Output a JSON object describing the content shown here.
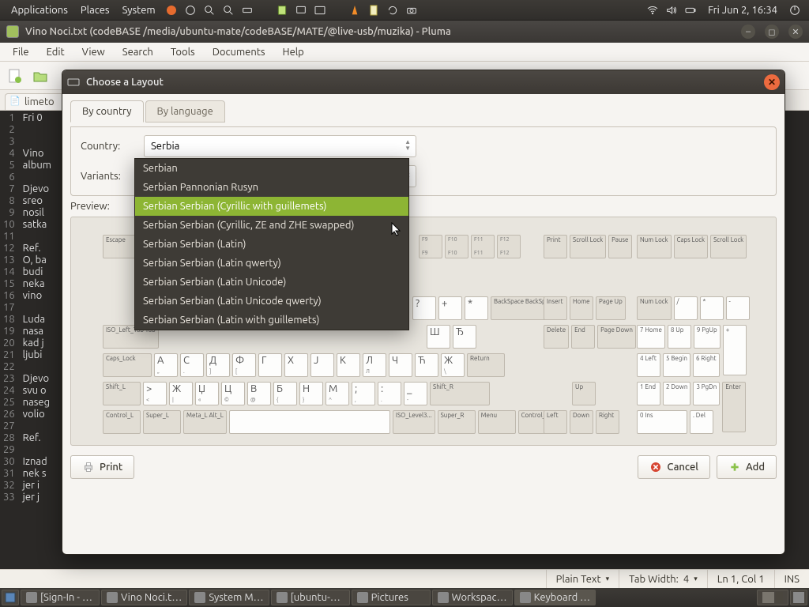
{
  "top_panel": {
    "menus": [
      "Applications",
      "Places",
      "System"
    ],
    "clock": "Fri Jun  2, 16:34"
  },
  "pluma": {
    "window_title": "Vino Noci.txt (codeBASE /media/ubuntu-mate/codeBASE/MATE/@live-usb/muzika) - Pluma",
    "menubar": [
      "File",
      "Edit",
      "View",
      "Search",
      "Tools",
      "Documents",
      "Help"
    ],
    "tab": "limeto",
    "code_lines": [
      "Fri 0",
      "",
      "",
      "Vino ",
      "album",
      "",
      "Djevo",
      "sreo ",
      "nosil",
      "satka",
      "",
      "Ref. ",
      "O, ba",
      "budi ",
      "neka ",
      "vino ",
      "",
      "Luda ",
      "nasa ",
      "kad j",
      "ljubi",
      "",
      "Djevo",
      "svu o",
      "naseg",
      "volio",
      "",
      "Ref. ",
      "",
      "Iznad",
      "nek s",
      "jer i",
      "jer j"
    ],
    "statusbar": {
      "lang": "Plain Text",
      "tabwidth_label": "Tab Width:",
      "tabwidth": "4",
      "pos": "Ln 1, Col 1",
      "mode": "INS"
    }
  },
  "dialog": {
    "title": "Choose a Layout",
    "tabs": [
      "By country",
      "By language"
    ],
    "country_label": "Country:",
    "country_value": "Serbia",
    "variants_label": "Variants:",
    "preview_label": "Preview:",
    "print": "Print",
    "cancel": "Cancel",
    "add": "Add",
    "dropdown": {
      "items": [
        "Serbian",
        "Serbian Pannonian Rusyn",
        "Serbian Serbian (Cyrillic with guillemets)",
        "Serbian Serbian (Cyrillic, ZE and ZHE swapped)",
        "Serbian Serbian (Latin)",
        "Serbian Serbian (Latin qwerty)",
        "Serbian Serbian (Latin Unicode)",
        "Serbian Serbian (Latin Unicode qwerty)",
        "Serbian Serbian (Latin with guillemets)"
      ],
      "selected_index": 2
    },
    "keyboard": {
      "esc": "Escape",
      "row_mods": {
        "iso_tab": "ISO_Left_Tab Tab",
        "caps": "Caps_Lock",
        "shift_l": "Shift_L",
        "shift_r": "Shift_R",
        "ctrl_l": "Control_L",
        "ctrl_r": "Control_R",
        "super_l": "Super_L",
        "super_r": "Super_R",
        "meta_alt": "Meta_L Alt_L",
        "iso3": "ISO_Level3...",
        "menu": "Menu",
        "return": "Return",
        "backspace": "BackSpace BackSpace"
      },
      "nav": {
        "print": "Print",
        "scroll": "Scroll Lock",
        "pause": "Pause",
        "ins": "Insert",
        "home": "Home",
        "pgup": "Page Up",
        "del": "Delete",
        "end": "End",
        "pgdn": "Page Down",
        "up": "Up",
        "down": "Down",
        "left": "Left",
        "right": "Right"
      },
      "numpad": {
        "num": "Num Lock",
        "caps": "Caps Lock",
        "scl": "Scroll Lock",
        "slash": "/",
        "star": "*",
        "minus": "-",
        "plus": "+",
        "enter": "Enter",
        "7": "7 Home",
        "8": "8 Up",
        "9": "9 PgUp",
        "4": "4 Left",
        "5": "5 Begin",
        "6": "6 Right",
        "1": "1 End",
        "2": "2 Down",
        "3": "3 PgDn",
        "0": "0 Ins",
        "dot": ". Del"
      },
      "fkeys_top": [
        "F9",
        "F9",
        "F10",
        "F10",
        "F11",
        "F11",
        "F12",
        "F12"
      ],
      "num_row_frag": [
        "?",
        "+",
        "*"
      ],
      "letter_row1": [
        "Ш",
        "Ђ"
      ],
      "letter_row2": [
        "А",
        "С",
        "Д",
        "Ф",
        "Г",
        "Х",
        "Ј",
        "К",
        "Л",
        "Ч",
        "Ћ",
        "Ж"
      ],
      "letter_row2_sub": [
        "„",
        ".",
        "]",
        "[",
        "",
        "",
        "",
        "",
        "Л",
        "",
        "",
        "\\"
      ],
      "letter_row3": [
        ">",
        "Ж",
        "Џ",
        "Ц",
        "В",
        "Б",
        "Н",
        "М",
        ";",
        ":",
        "_"
      ],
      "letter_row3_sub": [
        "<",
        "|",
        "«",
        "©",
        "@",
        "{",
        "}",
        "^",
        ",",
        ".",
        "-"
      ]
    }
  },
  "taskbar": {
    "items": [
      "[Sign-In - …",
      "Vino Noci.t…",
      "System M…",
      "[ubuntu-…",
      "Pictures",
      "Workspac…",
      "Keyboard …"
    ]
  }
}
